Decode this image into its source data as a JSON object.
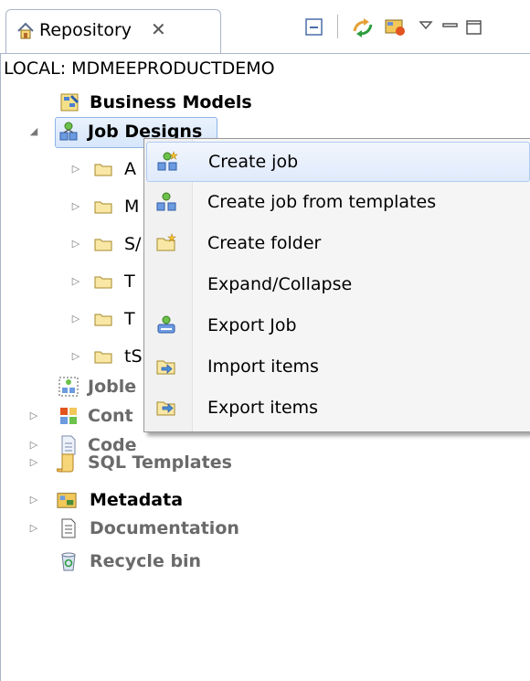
{
  "panel": {
    "tab_title": "Repository",
    "tab_close": "✕",
    "path": "LOCAL: MDMEEPRODUCTDEMO"
  },
  "tree": {
    "business_models": "Business Models",
    "job_designs": "Job Designs",
    "folders": [
      {
        "label": "A"
      },
      {
        "label": "M"
      },
      {
        "label": "S/"
      },
      {
        "label": "T"
      },
      {
        "label": "T"
      },
      {
        "label": "tS"
      }
    ],
    "joblets": "Joble",
    "contexts": "Cont",
    "code": "Code",
    "sql_templates": "SQL Templates",
    "metadata": "Metadata",
    "documentation": "Documentation",
    "recycle_bin": "Recycle bin"
  },
  "menu": {
    "items": [
      {
        "label": "Create job",
        "icon": "create-job-icon"
      },
      {
        "label": "Create job from templates",
        "icon": "job-template-icon"
      },
      {
        "label": "Create folder",
        "icon": "folder-new-icon"
      },
      {
        "label": "Expand/Collapse",
        "icon": ""
      },
      {
        "label": "Export Job",
        "icon": "export-job-icon"
      },
      {
        "label": "Import items",
        "icon": "import-items-icon"
      },
      {
        "label": "Export items",
        "icon": "export-items-icon"
      }
    ]
  }
}
